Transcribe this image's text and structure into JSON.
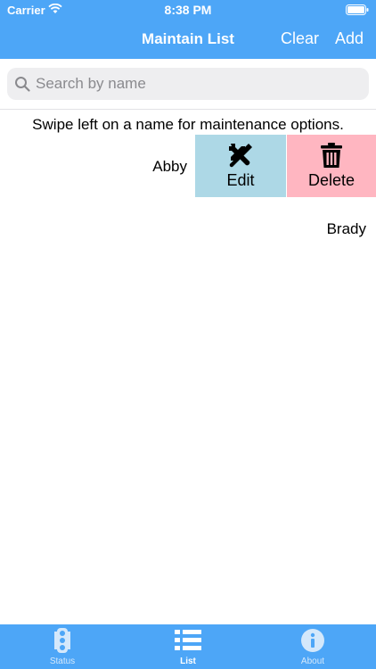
{
  "status_bar": {
    "carrier": "Carrier",
    "time": "8:38 PM"
  },
  "nav": {
    "title": "Maintain List",
    "clear_label": "Clear",
    "add_label": "Add"
  },
  "search": {
    "placeholder": "Search by name",
    "value": ""
  },
  "instruction": "Swipe left on a name for maintenance options.",
  "rows": [
    {
      "name": "Abby",
      "swiped": true
    },
    {
      "name": "Brady",
      "swiped": false
    }
  ],
  "swipe_actions": {
    "edit": {
      "label": "Edit",
      "icon": "wrench-screwdriver-icon",
      "color": "#add8e6"
    },
    "delete": {
      "label": "Delete",
      "icon": "trash-icon",
      "color": "#ffb6c1"
    }
  },
  "tabs": [
    {
      "label": "Status",
      "icon": "traffic-light-icon",
      "selected": false
    },
    {
      "label": "List",
      "icon": "list-icon",
      "selected": true
    },
    {
      "label": "About",
      "icon": "info-icon",
      "selected": false
    }
  ],
  "colors": {
    "accent": "#4da6f7",
    "text": "#000000"
  }
}
